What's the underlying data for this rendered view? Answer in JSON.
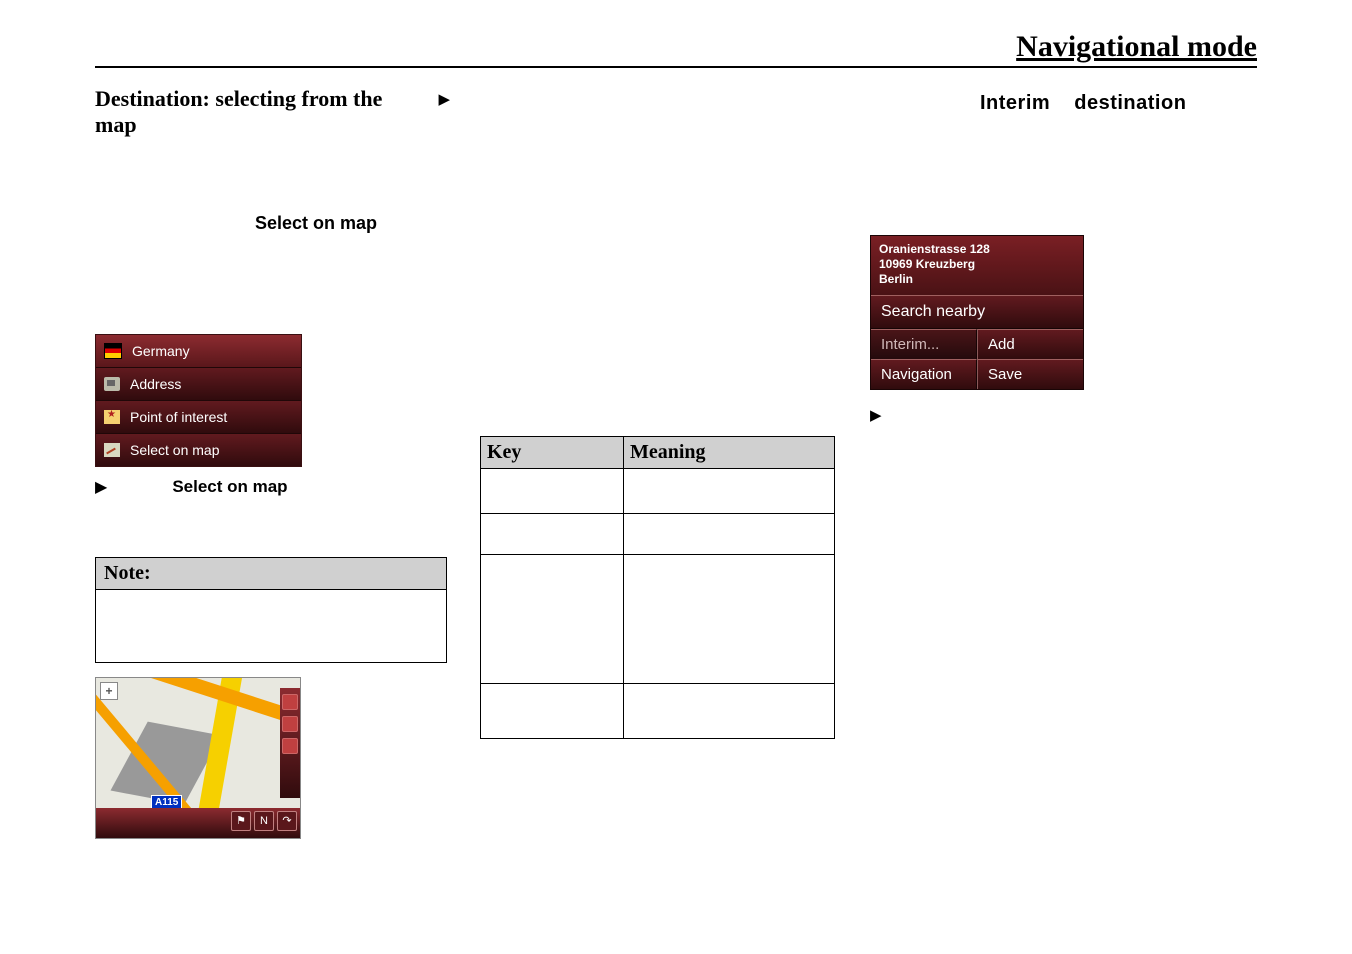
{
  "header": {
    "title": "Navigational mode"
  },
  "left": {
    "heading": "Destination: selecting from the map",
    "select_label": "Select on map",
    "menu": {
      "country": "Germany",
      "address": "Address",
      "poi": "Point of interest",
      "select_on_map": "Select on map"
    },
    "select_inline_label": "Select on map",
    "note_heading": "Note:",
    "map_badge": "A115"
  },
  "mid": {
    "key_header": "Key",
    "meaning_header": "Meaning"
  },
  "right": {
    "heading": "Interim destination",
    "popup": {
      "addr_line1": "Oranienstrasse 128",
      "addr_line2": "10969 Kreuzberg",
      "addr_line3": "Berlin",
      "search_nearby": "Search nearby",
      "interim": "Interim...",
      "add": "Add",
      "navigation": "Navigation",
      "save": "Save"
    }
  },
  "glyphs": {
    "arrow_right": "▶"
  }
}
